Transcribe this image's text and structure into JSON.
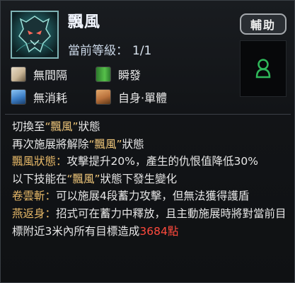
{
  "skill": {
    "name": "飄風",
    "level_label": "當前等級：",
    "level_value": "1/1",
    "icon": "wolf-head-skill-icon",
    "type_badge": "輔助"
  },
  "attributes": [
    {
      "icon": "interval-icon",
      "label": "無間隔"
    },
    {
      "icon": "instant-cast-icon",
      "label": "瞬發"
    },
    {
      "icon": "no-cost-icon",
      "label": "無消耗"
    },
    {
      "icon": "target-self-icon",
      "label": "自身·單體"
    }
  ],
  "description": {
    "line1": {
      "a": "切換至",
      "hl": "“飄風”",
      "b": "狀態"
    },
    "line2": {
      "a": "再次施展將解除",
      "hl": "“飄風”",
      "b": "狀態"
    },
    "state_effect": {
      "label": "飄風狀態：",
      "text": "攻擊提升20%，產生的仇恨值降低30%"
    },
    "line4": {
      "a": "以下技能在",
      "hl": "“飄風”",
      "b": "狀態下發生變化"
    },
    "change1": {
      "label": "卷雲斬：",
      "text": "可以施展4段蓄力攻擊，但無法獲得護盾"
    },
    "change2": {
      "label": "燕返身：",
      "text": "招式可在蓄力中釋放，且主動施展時將對當前目標附近3米內所有目標造成",
      "damage": "3684點"
    }
  },
  "colors": {
    "highlight": "#f0c77a",
    "label": "#e6b868",
    "damage": "#ff4a3d",
    "slot_icon": "#2fb85a"
  }
}
